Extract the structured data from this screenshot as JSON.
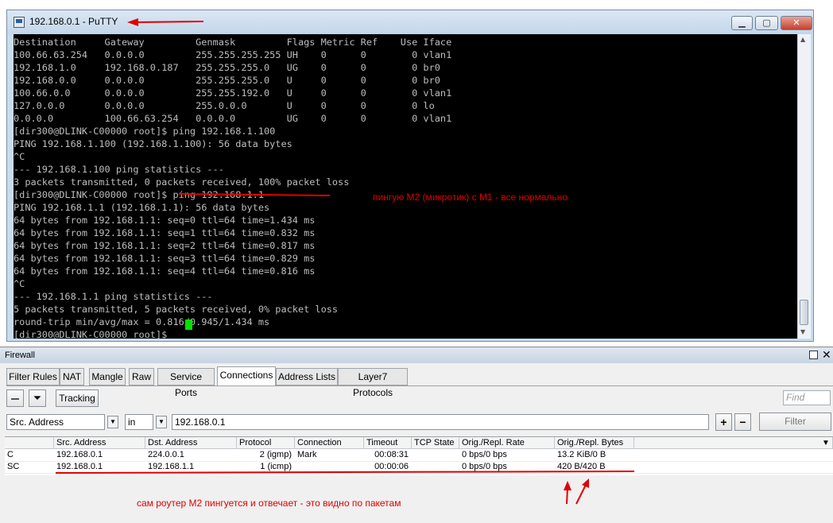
{
  "putty": {
    "title": "192.168.0.1 - PuTTY",
    "terminal_lines": [
      "Destination     Gateway         Genmask         Flags Metric Ref    Use Iface",
      "100.66.63.254   0.0.0.0         255.255.255.255 UH    0      0        0 vlan1",
      "192.168.1.0     192.168.0.187   255.255.255.0   UG    0      0        0 br0",
      "192.168.0.0     0.0.0.0         255.255.255.0   U     0      0        0 br0",
      "100.66.0.0      0.0.0.0         255.255.192.0   U     0      0        0 vlan1",
      "127.0.0.0       0.0.0.0         255.0.0.0       U     0      0        0 lo",
      "0.0.0.0         100.66.63.254   0.0.0.0         UG    0      0        0 vlan1",
      "[dir300@DLINK-C00000 root]$ ping 192.168.1.100",
      "PING 192.168.1.100 (192.168.1.100): 56 data bytes",
      "^C",
      "--- 192.168.1.100 ping statistics ---",
      "3 packets transmitted, 0 packets received, 100% packet loss",
      "[dir300@DLINK-C00000 root]$ ping 192.168.1.1",
      "PING 192.168.1.1 (192.168.1.1): 56 data bytes",
      "64 bytes from 192.168.1.1: seq=0 ttl=64 time=1.434 ms",
      "64 bytes from 192.168.1.1: seq=1 ttl=64 time=0.832 ms",
      "64 bytes from 192.168.1.1: seq=2 ttl=64 time=0.817 ms",
      "64 bytes from 192.168.1.1: seq=3 ttl=64 time=0.829 ms",
      "64 bytes from 192.168.1.1: seq=4 ttl=64 time=0.816 ms",
      "^C",
      "--- 192.168.1.1 ping statistics ---",
      "5 packets transmitted, 5 packets received, 0% packet loss",
      "round-trip min/avg/max = 0.816/0.945/1.434 ms",
      "[dir300@DLINK-C00000 root]$ "
    ]
  },
  "firewall": {
    "title": "Firewall",
    "tabs": [
      "Filter Rules",
      "NAT",
      "Mangle",
      "Raw",
      "Service Ports",
      "Connections",
      "Address Lists",
      "Layer7 Protocols"
    ],
    "active_tab": "Connections",
    "tracking_label": "Tracking",
    "find_placeholder": "Find",
    "filter": {
      "field": "Src. Address",
      "operator": "in",
      "value": "192.168.0.1",
      "apply_label": "Filter"
    },
    "columns": [
      "",
      "Src. Address",
      "Dst. Address",
      "Protocol",
      "Connection Mark",
      "Timeout",
      "TCP State",
      "Orig./Repl. Rate",
      "Orig./Repl. Bytes"
    ],
    "rows": [
      {
        "flags": "C",
        "src": "192.168.0.1",
        "dst": "224.0.0.1",
        "protocol": "2 (igmp)",
        "mark": "",
        "timeout": "00:08:31",
        "tcp_state": "",
        "rate": "0 bps/0 bps",
        "bytes": "13.2 KiB/0 B"
      },
      {
        "flags": "SC",
        "src": "192.168.0.1",
        "dst": "192.168.1.1",
        "protocol": "1 (icmp)",
        "mark": "",
        "timeout": "00:00:06",
        "tcp_state": "",
        "rate": "0 bps/0 bps",
        "bytes": "420 B/420 B"
      }
    ]
  },
  "annotations": {
    "ping_note": "пингую М2 (микротик) с М1 - все нормально",
    "reply_note": "сам роутер М2 пингуется и отвечает - это видно по пакетам",
    "color": "#e10000"
  }
}
